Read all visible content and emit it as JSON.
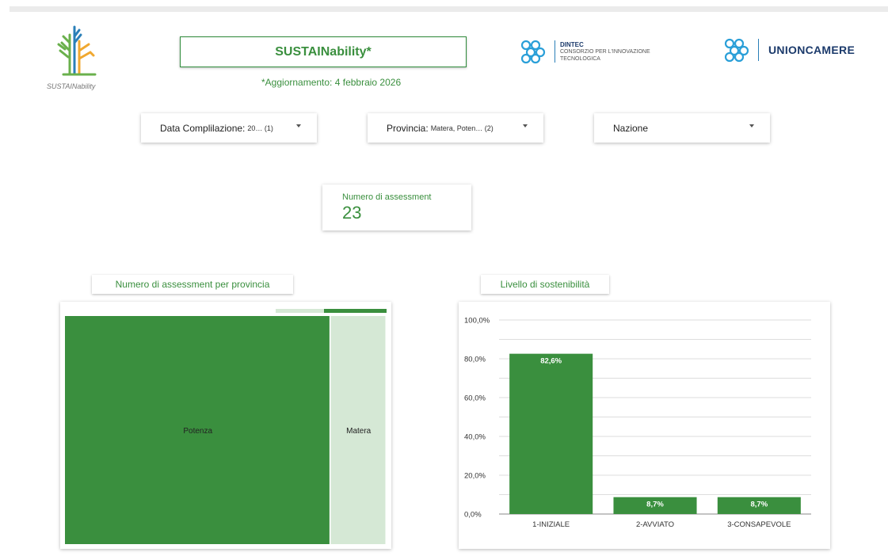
{
  "header": {
    "logo_caption": "SUSTAINability",
    "title": "SUSTAINability*",
    "update": "*Aggiornamento: 4 febbraio 2026",
    "partners": {
      "dintec_name": "DINTEC",
      "dintec_line1": "CONSORZIO PER L'INNOVAZIONE",
      "dintec_line2": "TECNOLOGICA",
      "unioncamere": "UNIONCAMERE"
    }
  },
  "filters": [
    {
      "label": "Data Complilazione:",
      "value": "20… (1)"
    },
    {
      "label": "Provincia:",
      "value": "Matera, Poten… (2)"
    },
    {
      "label": "Nazione",
      "value": ""
    }
  ],
  "scorecard": {
    "label": "Numero di assessment",
    "value": "23"
  },
  "colors": {
    "green": "#3a8f3e",
    "light_green": "#d5e8d5",
    "grid": "#dddddd"
  },
  "chart_data": [
    {
      "type": "treemap",
      "title": "Numero di assessment per provincia",
      "categories": [
        "Potenza",
        "Matera"
      ],
      "values": [
        19,
        4
      ]
    },
    {
      "type": "bar",
      "title": "Livello di sostenibilità",
      "categories": [
        "1-INIZIALE",
        "2-AVVIATO",
        "3-CONSAPEVOLE"
      ],
      "values": [
        82.6,
        8.7,
        8.7
      ],
      "value_labels": [
        "82,6%",
        "8,7%",
        "8,7%"
      ],
      "ylim": [
        0,
        100
      ],
      "yticks": [
        "0,0%",
        "20,0%",
        "40,0%",
        "60,0%",
        "80,0%",
        "100,0%"
      ],
      "grid": true
    }
  ]
}
